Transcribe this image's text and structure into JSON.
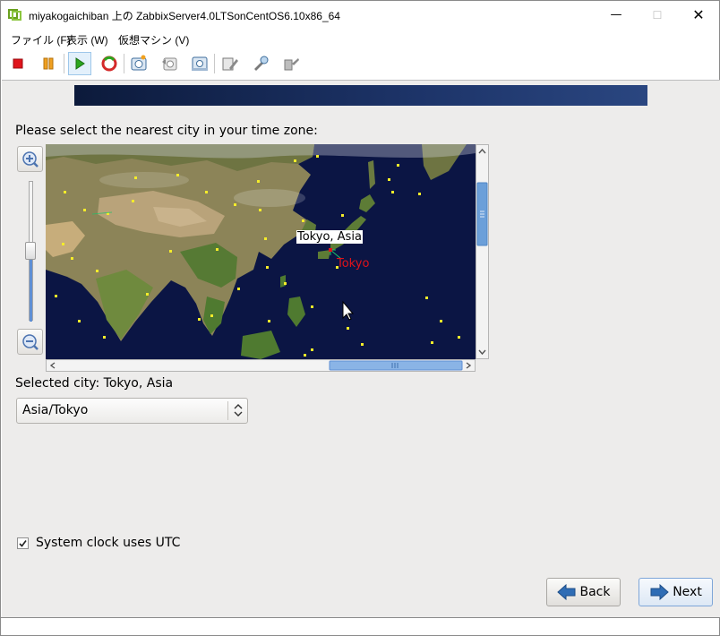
{
  "window": {
    "title": "miyakogaichiban 上の ZabbixServer4.0LTSonCentOS6.10x86_64",
    "minimize_glyph": "—",
    "maximize_glyph": "☐",
    "close_glyph": "✕"
  },
  "menu": {
    "items": [
      {
        "label": "ファイル (F)"
      },
      {
        "label": "表示 (W)"
      },
      {
        "label": "仮想マシン (V)"
      }
    ]
  },
  "toolbar": {
    "buttons": [
      {
        "icon": "stop-icon",
        "color": "#e0141b"
      },
      {
        "icon": "pause-icon",
        "color": "#f0a020"
      },
      {
        "icon": "play-icon",
        "color": "#2ba61e",
        "active": true
      },
      {
        "icon": "reset-icon",
        "color": "#d42a2a"
      },
      {
        "icon": "snapshot-icon"
      },
      {
        "icon": "revert-snapshot-icon"
      },
      {
        "icon": "manage-snapshots-icon"
      },
      {
        "icon": "edit-settings-icon"
      },
      {
        "icon": "vm-tools-icon"
      },
      {
        "icon": "connect-devices-icon"
      }
    ]
  },
  "installer": {
    "prompt": "Please select the nearest city in your time zone:",
    "map": {
      "hover_label": "Tokyo, Asia",
      "selected_marker_label": "Tokyo",
      "marker_color": "#e0131a"
    },
    "selected_city_text": "Selected city: Tokyo, Asia",
    "timezone_select": {
      "value": "Asia/Tokyo"
    },
    "utc_checkbox": {
      "label": "System clock uses UTC",
      "checked": true
    },
    "buttons": {
      "back": "Back",
      "next": "Next"
    }
  },
  "colors": {
    "console_bg": "#edeceb",
    "banner_dark": "#0c1a3b",
    "ocean": "#0b1544",
    "accent_blue": "#5f8fd4"
  }
}
